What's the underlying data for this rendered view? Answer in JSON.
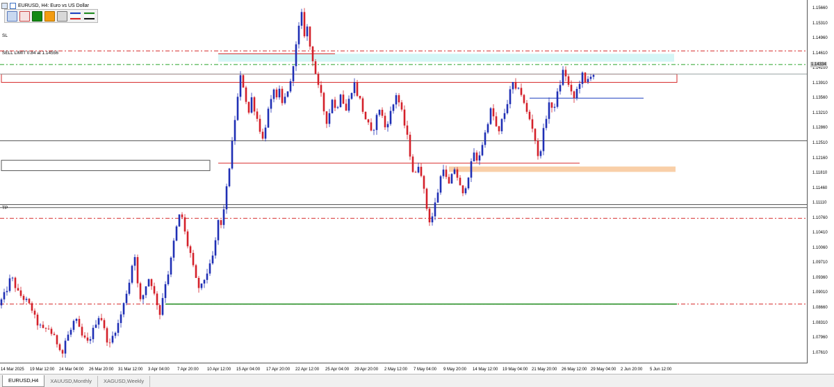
{
  "window": {
    "title": "EURUSD, H4:  Euro vs US Dollar"
  },
  "toolbar": {
    "buttons": [
      {
        "icon": "blue-square-icon",
        "color": "#c8d8f0",
        "border": "#5a7bbd"
      },
      {
        "icon": "red-outline-square-icon",
        "color": "#f6e1e1",
        "border": "#c44"
      },
      {
        "icon": "green-square-icon",
        "color": "#138a13",
        "border": "#0b5f0b"
      },
      {
        "icon": "orange-square-icon",
        "color": "#f39c12",
        "border": "#b06e00"
      },
      {
        "icon": "gray-square-icon",
        "color": "#d8d8d8",
        "border": "#777"
      }
    ],
    "line_sets": [
      {
        "icon": "blue-red-lines-icon",
        "colors": [
          "#1b3fbf",
          "#ffffff",
          "#d62222"
        ]
      },
      {
        "icon": "green-black-lines-icon",
        "colors": [
          "#1a8a1a",
          "#ffffff",
          "#111111"
        ]
      }
    ]
  },
  "labels": {
    "sl": "SL",
    "sell_limit": "SELL LIMIT 0.84 at 1.14556",
    "tp": "TP"
  },
  "price_axis": {
    "ticks": [
      "1.15660",
      "1.15310",
      "1.14960",
      "1.14610",
      "1.14260",
      "1.13910",
      "1.13560",
      "1.13210",
      "1.12860",
      "1.12510",
      "1.12160",
      "1.11810",
      "1.11460",
      "1.11110",
      "1.10760",
      "1.10410",
      "1.10060",
      "1.09710",
      "1.09360",
      "1.09010",
      "1.08660",
      "1.08310",
      "1.07960",
      "1.07610"
    ],
    "current_price": "1.14334"
  },
  "time_axis": {
    "ticks": [
      "14 Mar 2025",
      "19 Mar 12:00",
      "24 Mar 04:00",
      "26 Mar 20:00",
      "31 Mar 12:00",
      "3 Apr 04:00",
      "7 Apr 20:00",
      "10 Apr 12:00",
      "15 Apr 04:00",
      "17 Apr 20:00",
      "22 Apr 12:00",
      "25 Apr 04:00",
      "29 Apr 20:00",
      "2 May 12:00",
      "7 May 04:00",
      "9 May 20:00",
      "14 May 12:00",
      "19 May 04:00",
      "21 May 20:00",
      "26 May 12:00",
      "29 May 04:00",
      "2 Jun 20:00",
      "5 Jun 12:00"
    ]
  },
  "chart_data": {
    "type": "candlestick",
    "symbol": "EURUSD",
    "timeframe": "H4",
    "ylim": [
      1.074,
      1.16
    ],
    "x_range": [
      "14 Mar 2025",
      "5 Jun 12:00"
    ],
    "path": [
      [
        0,
        1.0875
      ],
      [
        5,
        1.0905
      ],
      [
        9,
        1.0945
      ],
      [
        14,
        1.0905
      ],
      [
        20,
        1.0885
      ],
      [
        24,
        1.0865
      ],
      [
        27,
        1.0835
      ],
      [
        32,
        1.0815
      ],
      [
        36,
        1.082
      ],
      [
        41,
        1.079
      ],
      [
        44,
        1.0775
      ],
      [
        46,
        1.076
      ],
      [
        48,
        1.079
      ],
      [
        52,
        1.0815
      ],
      [
        55,
        1.0845
      ],
      [
        57,
        1.0825
      ],
      [
        60,
        1.08
      ],
      [
        64,
        1.0785
      ],
      [
        67,
        1.0805
      ],
      [
        70,
        1.0835
      ],
      [
        73,
        1.0855
      ],
      [
        75,
        1.083
      ],
      [
        77,
        1.08
      ],
      [
        80,
        1.078
      ],
      [
        83,
        1.081
      ],
      [
        86,
        1.083
      ],
      [
        89,
        1.0865
      ],
      [
        91,
        1.089
      ],
      [
        93,
        1.0925
      ],
      [
        95,
        1.094
      ],
      [
        97,
        1.1005
      ],
      [
        99,
        1.099
      ],
      [
        100,
        1.0925
      ],
      [
        102,
        1.0885
      ],
      [
        104,
        1.09
      ],
      [
        107,
        1.0935
      ],
      [
        109,
        1.0945
      ],
      [
        111,
        1.091
      ],
      [
        114,
        1.088
      ],
      [
        116,
        1.0855
      ],
      [
        118,
        1.0895
      ],
      [
        120,
        1.093
      ],
      [
        123,
        1.0965
      ],
      [
        125,
        1.1005
      ],
      [
        127,
        1.105
      ],
      [
        129,
        1.1075
      ],
      [
        131,
        1.1105
      ],
      [
        133,
        1.107
      ],
      [
        135,
        1.103
      ],
      [
        138,
        1.1
      ],
      [
        140,
        1.0965
      ],
      [
        142,
        1.0935
      ],
      [
        145,
        1.091
      ],
      [
        147,
        1.093
      ],
      [
        150,
        1.0955
      ],
      [
        153,
        1.0975
      ],
      [
        155,
        1.101
      ],
      [
        157,
        1.1045
      ],
      [
        158,
        1.108
      ],
      [
        160,
        1.1065
      ],
      [
        162,
        1.111
      ],
      [
        164,
        1.1155
      ],
      [
        166,
        1.121
      ],
      [
        168,
        1.1265
      ],
      [
        170,
        1.1325
      ],
      [
        172,
        1.1375
      ],
      [
        174,
        1.1425
      ],
      [
        176,
        1.1405
      ],
      [
        178,
        1.137
      ],
      [
        180,
        1.134
      ],
      [
        182,
        1.1375
      ],
      [
        184,
        1.135
      ],
      [
        186,
        1.1325
      ],
      [
        188,
        1.13
      ],
      [
        190,
        1.1275
      ],
      [
        192,
        1.131
      ],
      [
        194,
        1.1345
      ],
      [
        196,
        1.1365
      ],
      [
        198,
        1.14
      ],
      [
        200,
        1.137
      ],
      [
        202,
        1.139
      ],
      [
        204,
        1.136
      ],
      [
        206,
        1.1375
      ],
      [
        208,
        1.1395
      ],
      [
        210,
        1.141
      ],
      [
        212,
        1.146
      ],
      [
        214,
        1.15
      ],
      [
        216,
        1.1545
      ],
      [
        218,
        1.1575
      ],
      [
        220,
        1.153
      ],
      [
        222,
        1.1545
      ],
      [
        224,
        1.15
      ],
      [
        226,
        1.147
      ],
      [
        228,
        1.1435
      ],
      [
        230,
        1.14
      ],
      [
        232,
        1.138
      ],
      [
        234,
        1.1345
      ],
      [
        236,
        1.132
      ],
      [
        238,
        1.134
      ],
      [
        240,
        1.1375
      ],
      [
        242,
        1.135
      ],
      [
        244,
        1.136
      ],
      [
        246,
        1.139
      ],
      [
        248,
        1.1365
      ],
      [
        250,
        1.1345
      ],
      [
        252,
        1.137
      ],
      [
        254,
        1.1395
      ],
      [
        256,
        1.141
      ],
      [
        258,
        1.1385
      ],
      [
        260,
        1.137
      ],
      [
        262,
        1.1345
      ],
      [
        264,
        1.1325
      ],
      [
        266,
        1.131
      ],
      [
        268,
        1.129
      ],
      [
        270,
        1.1305
      ],
      [
        272,
        1.133
      ],
      [
        274,
        1.135
      ],
      [
        276,
        1.133
      ],
      [
        278,
        1.1305
      ],
      [
        280,
        1.132
      ],
      [
        282,
        1.134
      ],
      [
        284,
        1.136
      ],
      [
        286,
        1.1385
      ],
      [
        288,
        1.1365
      ],
      [
        290,
        1.134
      ],
      [
        292,
        1.131
      ],
      [
        294,
        1.128
      ],
      [
        296,
        1.124
      ],
      [
        298,
        1.12
      ],
      [
        300,
        1.119
      ],
      [
        302,
        1.1215
      ],
      [
        304,
        1.1195
      ],
      [
        306,
        1.115
      ],
      [
        308,
        1.111
      ],
      [
        310,
        1.108
      ],
      [
        312,
        1.109
      ],
      [
        314,
        1.112
      ],
      [
        316,
        1.115
      ],
      [
        318,
        1.1185
      ],
      [
        320,
        1.121
      ],
      [
        322,
        1.118
      ],
      [
        324,
        1.1165
      ],
      [
        326,
        1.1185
      ],
      [
        328,
        1.1205
      ],
      [
        330,
        1.1185
      ],
      [
        332,
        1.116
      ],
      [
        334,
        1.114
      ],
      [
        336,
        1.1165
      ],
      [
        338,
        1.119
      ],
      [
        340,
        1.1215
      ],
      [
        342,
        1.1245
      ],
      [
        344,
        1.122
      ],
      [
        346,
        1.124
      ],
      [
        348,
        1.1265
      ],
      [
        350,
        1.129
      ],
      [
        352,
        1.132
      ],
      [
        354,
        1.1345
      ],
      [
        356,
        1.133
      ],
      [
        358,
        1.1305
      ],
      [
        360,
        1.129
      ],
      [
        362,
        1.132
      ],
      [
        364,
        1.134
      ],
      [
        366,
        1.1365
      ],
      [
        368,
        1.139
      ],
      [
        370,
        1.141
      ],
      [
        372,
        1.139
      ],
      [
        374,
        1.1405
      ],
      [
        376,
        1.1385
      ],
      [
        378,
        1.136
      ],
      [
        380,
        1.134
      ],
      [
        382,
        1.1325
      ],
      [
        384,
        1.1305
      ],
      [
        386,
        1.1275
      ],
      [
        388,
        1.123
      ],
      [
        390,
        1.1255
      ],
      [
        392,
        1.1295
      ],
      [
        394,
        1.133
      ],
      [
        396,
        1.1365
      ],
      [
        398,
        1.1345
      ],
      [
        400,
        1.136
      ],
      [
        402,
        1.1385
      ],
      [
        404,
        1.141
      ],
      [
        406,
        1.144
      ],
      [
        408,
        1.143
      ],
      [
        410,
        1.1405
      ],
      [
        412,
        1.1385
      ],
      [
        414,
        1.1375
      ],
      [
        416,
        1.1395
      ],
      [
        418,
        1.1415
      ],
      [
        420,
        1.143
      ],
      [
        422,
        1.141
      ],
      [
        424,
        1.142
      ],
      [
        426,
        1.1433
      ]
    ],
    "candle_colors": {
      "up": "#1f2fb5",
      "down": "#d4202a"
    },
    "zones": [
      {
        "name": "sell-zone",
        "x_from": 156,
        "x_to": 484,
        "y_from": 1.1482,
        "y_to": 1.1463,
        "fill": "#d5f6f6",
        "stroke": ""
      },
      {
        "name": "supply-box",
        "x_from": 0,
        "x_to": 486,
        "y_from": 1.1433,
        "y_to": 1.1413,
        "fill": "",
        "stroke": "#d62828"
      },
      {
        "name": "demand-zone",
        "x_from": 322,
        "x_to": 485,
        "y_from": 1.121,
        "y_to": 1.1197,
        "fill": "#f9cfa8",
        "stroke": ""
      },
      {
        "name": "gray-box",
        "x_from": 0,
        "x_to": 150,
        "y_from": 1.1225,
        "y_to": 1.12,
        "fill": "",
        "stroke": "#555555"
      }
    ],
    "levels": [
      {
        "name": "sl-line",
        "y": 1.1489,
        "color": "#d62828",
        "style": "dashdot"
      },
      {
        "name": "sell-limit-line",
        "y": 1.1456,
        "color": "#2aa52a",
        "style": "dashdot"
      },
      {
        "name": "current-price-line",
        "y": 1.1433,
        "color": "#9aa3a3",
        "style": "solid"
      },
      {
        "name": "tp-line",
        "y": 1.1085,
        "color": "#d62828",
        "style": "dashdot"
      },
      {
        "name": "support-line-1",
        "y": 1.1272,
        "color": "#555555",
        "style": "solid"
      },
      {
        "name": "support-line-2",
        "y": 1.1118,
        "color": "#555555",
        "style": "solid"
      },
      {
        "name": "support-line-3",
        "y": 1.1111,
        "color": "#555555",
        "style": "solid"
      },
      {
        "name": "entry-line",
        "y": 1.0878,
        "color": "#d62828",
        "style": "dashdot"
      }
    ],
    "segments": [
      {
        "name": "resistance-segment",
        "x_from": 156,
        "x_to": 240,
        "y": 1.1482,
        "color": "#d62828"
      },
      {
        "name": "mid-range-line",
        "x_from": 156,
        "x_to": 416,
        "y": 1.1218,
        "color": "#d62828"
      },
      {
        "name": "blue-trend-line",
        "x_from": 380,
        "x_to": 462,
        "y": 1.1375,
        "color": "#1b3fbf"
      },
      {
        "name": "green-support-line",
        "x_from": 118,
        "x_to": 486,
        "y": 1.0878,
        "color": "#1a8a1a"
      }
    ]
  },
  "tabs": [
    {
      "label": "EURUSD,H4",
      "active": true
    },
    {
      "label": "XAUUSD,Monthly",
      "active": false
    },
    {
      "label": "XAGUSD,Weekly",
      "active": false
    }
  ]
}
